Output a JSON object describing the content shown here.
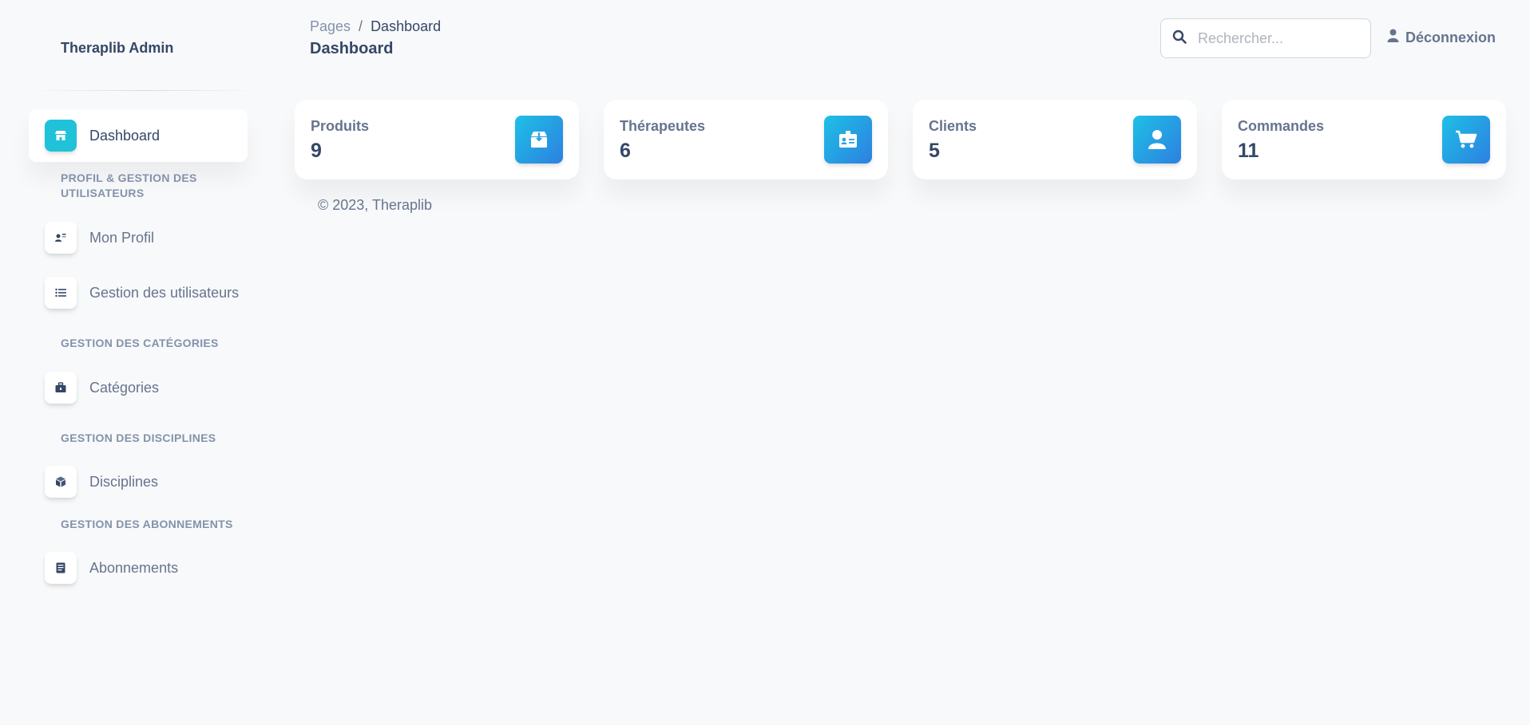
{
  "sidebar": {
    "brand": "Theraplib Admin",
    "active_item": {
      "label": "Dashboard",
      "icon": "shop-icon"
    },
    "sections": [
      {
        "title": "PROFIL & GESTION DES UTILISATEURS",
        "items": [
          {
            "label": "Mon Profil",
            "icon": "user-tie-icon"
          },
          {
            "label": "Gestion des utilisateurs",
            "icon": "list-icon"
          }
        ]
      },
      {
        "title": "GESTION DES CATÉGORIES",
        "items": [
          {
            "label": "Catégories",
            "icon": "briefcase-icon"
          }
        ]
      },
      {
        "title": "GESTION DES DISCIPLINES",
        "items": [
          {
            "label": "Disciplines",
            "icon": "cube-icon"
          }
        ]
      },
      {
        "title": "GESTION DES ABONNEMENTS",
        "items": [
          {
            "label": "Abonnements",
            "icon": "document-icon"
          }
        ]
      }
    ]
  },
  "header": {
    "breadcrumb": [
      "Pages",
      "Dashboard"
    ],
    "breadcrumb_sep": "/",
    "title": "Dashboard",
    "search_placeholder": "Rechercher...",
    "logout_label": "Déconnexion"
  },
  "cards": [
    {
      "label": "Produits",
      "value": "9",
      "icon": "box-icon"
    },
    {
      "label": "Thérapeutes",
      "value": "6",
      "icon": "id-card-icon"
    },
    {
      "label": "Clients",
      "value": "5",
      "icon": "user-icon"
    },
    {
      "label": "Commandes",
      "value": "11",
      "icon": "cart-icon"
    }
  ],
  "footer": {
    "text": "© 2023, Theraplib"
  },
  "colors": {
    "primary_text": "#344767",
    "muted_text": "#67748e",
    "accent_gradient_start": "#1ec0e6",
    "accent_gradient_end": "#2d80e0",
    "background": "#f8f9fa"
  }
}
